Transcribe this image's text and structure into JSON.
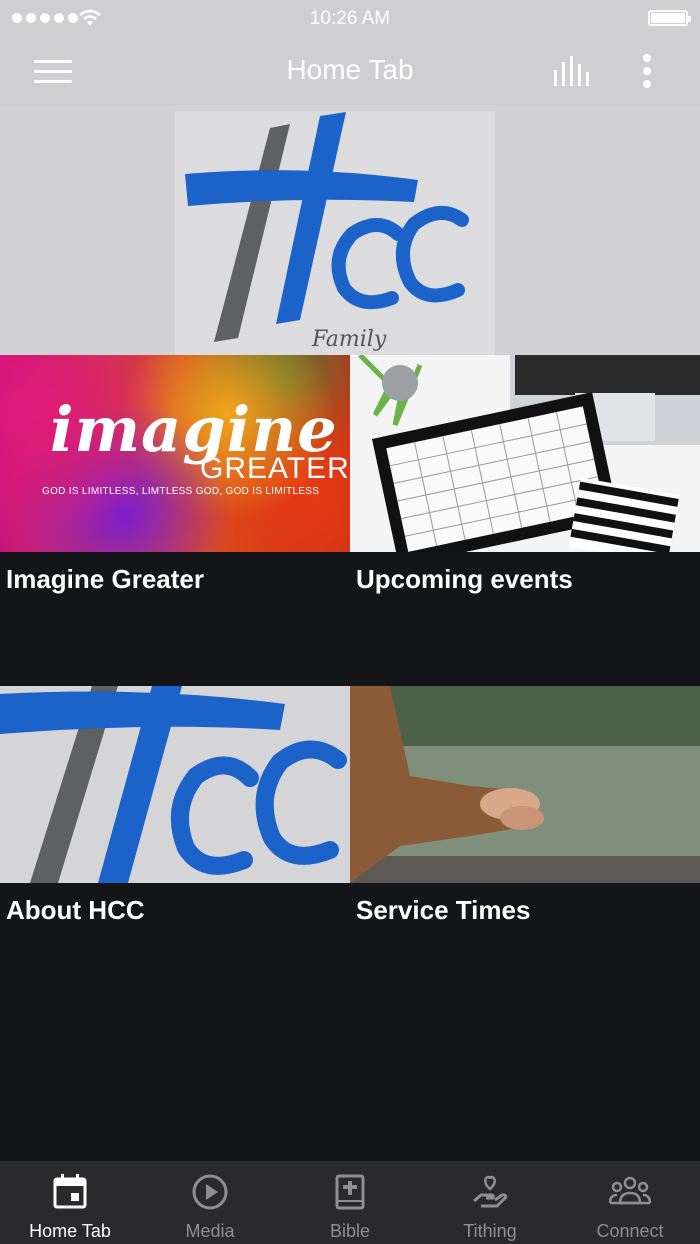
{
  "status_bar": {
    "time": "10:26 AM"
  },
  "nav": {
    "title": "Home Tab",
    "icons": {
      "menu": "hamburger-icon",
      "audio": "audio-levels-icon",
      "more": "more-vertical-icon"
    }
  },
  "banner": {
    "logo_text": "HCC",
    "logo_sub": "Family"
  },
  "tiles": [
    {
      "label": "Imagine Greater",
      "image_text": {
        "word1": "imagine",
        "word2": "GREATER",
        "tag": "GOD IS LIMITLESS, LIMTLESS GOD, GOD IS LIMITLESS"
      }
    },
    {
      "label": "Upcoming events"
    },
    {
      "label": "About HCC"
    },
    {
      "label": "Service Times"
    }
  ],
  "tab_bar": {
    "active": "Home Tab",
    "items": [
      {
        "label": "Home Tab",
        "icon": "calendar-icon"
      },
      {
        "label": "Media",
        "icon": "play-circle-icon"
      },
      {
        "label": "Bible",
        "icon": "bible-icon"
      },
      {
        "label": "Tithing",
        "icon": "hand-heart-icon"
      },
      {
        "label": "Connect",
        "icon": "group-icon"
      }
    ]
  },
  "colors": {
    "header_bg": "#cfcfd1",
    "content_bg": "#141518",
    "tab_bar_bg": "#2a2a2d",
    "logo_blue": "#1b63c9",
    "logo_gray": "#5e6064"
  }
}
